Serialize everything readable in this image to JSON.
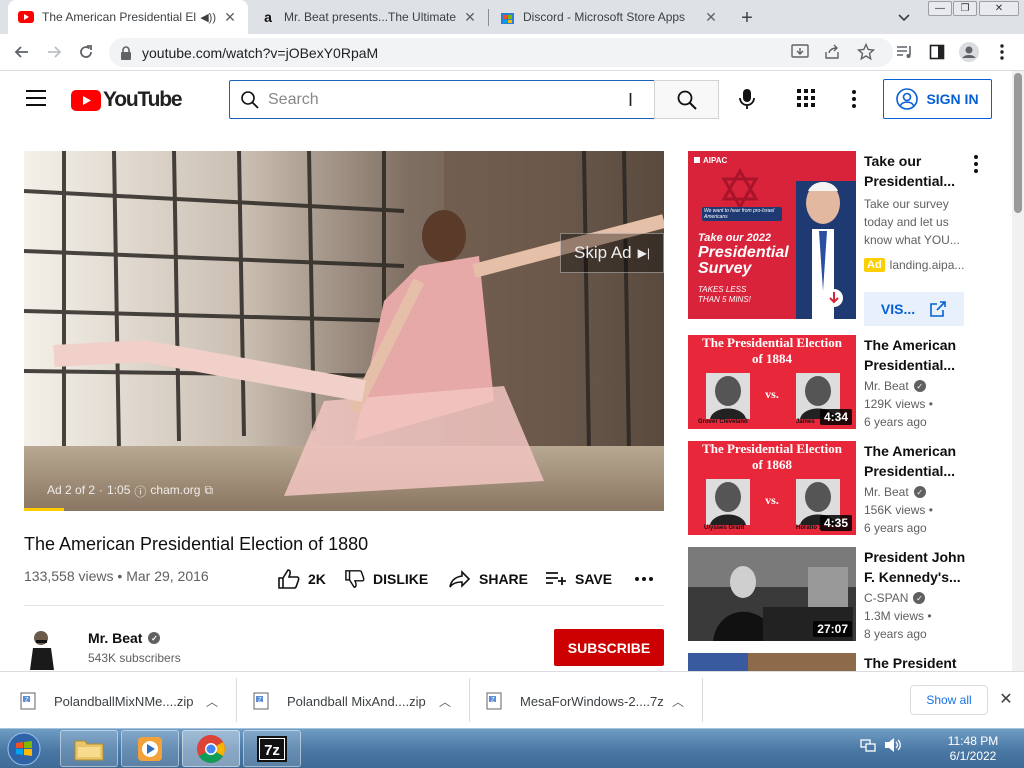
{
  "browser": {
    "tabs": [
      {
        "title": "The American Presidential El",
        "favicon": "youtube-icon",
        "active": true
      },
      {
        "title": "Mr. Beat presents...The Ultimate",
        "favicon": "amazon-icon",
        "active": false
      },
      {
        "title": "Discord - Microsoft Store Apps",
        "favicon": "microsoft-store-icon",
        "active": false
      }
    ],
    "url": "youtube.com/watch?v=jOBexY0RpaM"
  },
  "youtube": {
    "logo_text": "YouTube",
    "search_placeholder": "Search",
    "signin_label": "SIGN IN"
  },
  "player": {
    "skip_ad_label": "Skip Ad",
    "ad_counter": "Ad 2 of 2",
    "ad_time": "1:05",
    "ad_domain": "cham.org"
  },
  "video": {
    "title": "The American Presidential Election of 1880",
    "views": "133,558 views",
    "date": "Mar 29, 2016",
    "like_count": "2K",
    "dislike_label": "DISLIKE",
    "share_label": "SHARE",
    "save_label": "SAVE",
    "channel_name": "Mr. Beat",
    "subscribers": "543K subscribers",
    "subscribe_label": "SUBSCRIBE"
  },
  "sidebar": {
    "ad": {
      "title": "Take our Presidential...",
      "description": "Take our survey today and let us know what YOU...",
      "ad_label": "Ad",
      "domain": "landing.aipa...",
      "visit_label": "VIS...",
      "thumb_brand": "AIPAC",
      "thumb_tagline": "We want to hear from pro-Israel Americans",
      "thumb_headline_top": "Take our 2022",
      "thumb_headline_bottom": "Presidential Survey",
      "thumb_note": "TAKES LESS THAN 5 MINS!"
    },
    "recommendations": [
      {
        "title": "The American Presidential...",
        "channel": "Mr. Beat",
        "verified": true,
        "views": "129K views •",
        "age": "6 years ago",
        "duration": "4:34",
        "thumb_title": "The Presidential Election of 1884",
        "thumb_left": "Grover Cleveland",
        "thumb_right": "James"
      },
      {
        "title": "The American Presidential...",
        "channel": "Mr. Beat",
        "verified": true,
        "views": "156K views •",
        "age": "6 years ago",
        "duration": "4:35",
        "thumb_title": "The Presidential Election of 1868",
        "thumb_left": "Ulysses Grant",
        "thumb_right": "Horatio S"
      },
      {
        "title": "President John F. Kennedy's...",
        "channel": "C-SPAN",
        "verified": true,
        "views": "1.3M views •",
        "age": "8 years ago",
        "duration": "27:07"
      },
      {
        "title": "The President",
        "channel": "",
        "views": "",
        "age": "",
        "duration": ""
      }
    ]
  },
  "downloads": {
    "items": [
      {
        "name": "PolandballMixNMe....zip"
      },
      {
        "name": "Polandball MixAnd....zip"
      },
      {
        "name": "MesaForWindows-2....7z"
      }
    ],
    "show_all_label": "Show all"
  },
  "taskbar": {
    "time": "11:48 PM",
    "date": "6/1/2022"
  },
  "colors": {
    "youtube_red": "#ff0000",
    "subscribe_red": "#cc0000",
    "link_blue": "#065fd4"
  }
}
